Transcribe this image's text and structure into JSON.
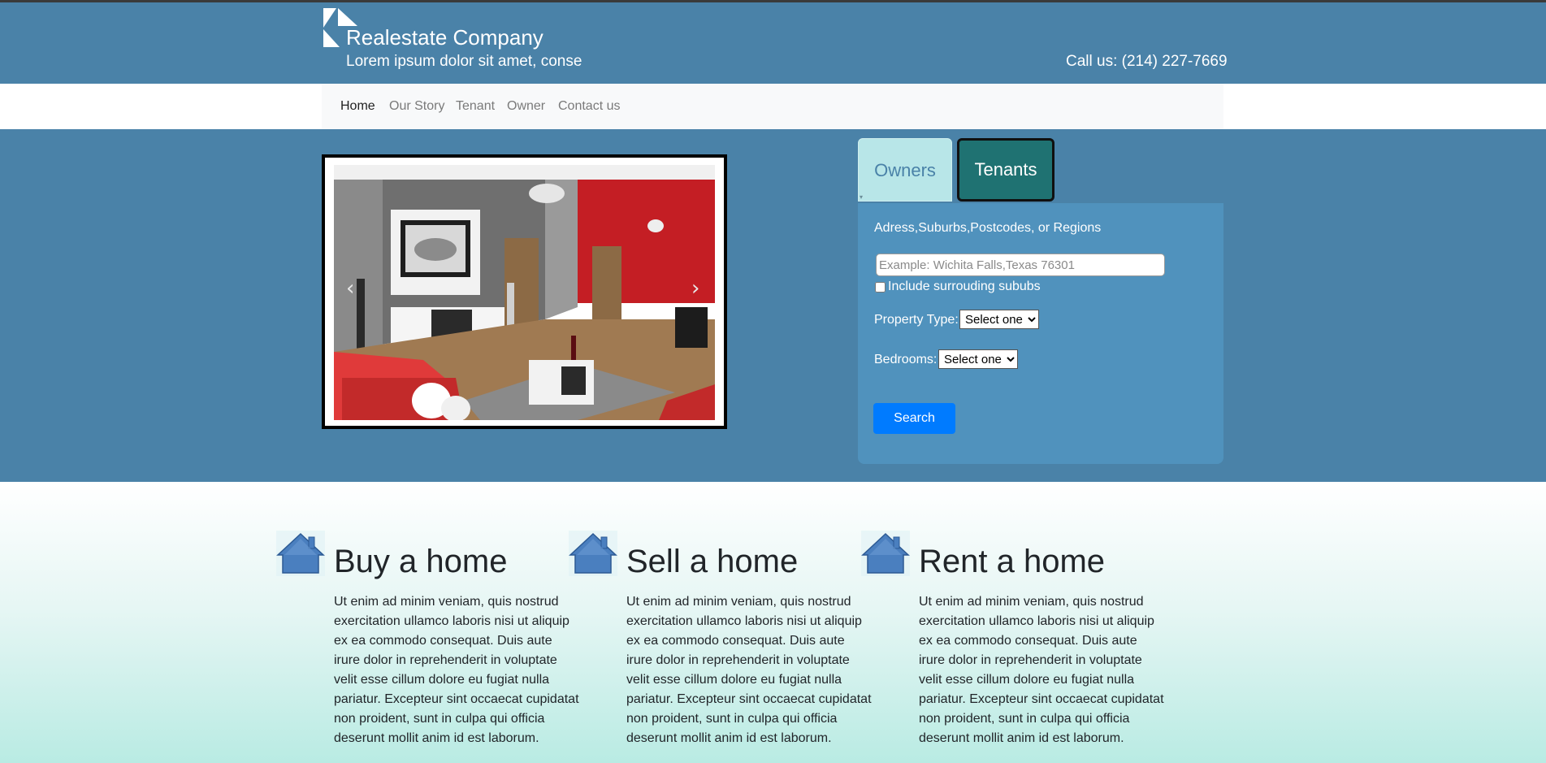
{
  "brand": {
    "title": "Realestate Company",
    "tagline": "Lorem ipsum dolor sit amet, conse",
    "phone": "Call us: (214) 227-7669"
  },
  "nav": {
    "items": [
      {
        "label": "Home",
        "active": true
      },
      {
        "label": "Our Story",
        "active": false
      },
      {
        "label": "Tenant",
        "active": false
      },
      {
        "label": "Owner",
        "active": false
      },
      {
        "label": "Contact us",
        "active": false
      }
    ]
  },
  "carousel": {
    "prev_icon": "chevron-left-icon",
    "next_icon": "chevron-right-icon"
  },
  "search": {
    "tabs": [
      {
        "label": "Owners",
        "selected": false
      },
      {
        "label": "Tenants",
        "selected": true
      }
    ],
    "address_label": "Adress,Suburbs,Postcodes, or Regions",
    "address_value": "",
    "address_placeholder": "Example: Wichita Falls,Texas 76301",
    "include_label": "Include surrouding sububs",
    "include_checked": false,
    "property_type_label": "Property Type:",
    "property_type_value": "Select one",
    "bedrooms_label": "Bedrooms:",
    "bedrooms_value": "Select one",
    "search_button": "Search"
  },
  "features": [
    {
      "title": "Buy a home",
      "icon": "house-icon",
      "text": "Ut enim ad minim veniam, quis nostrud exercitation ullamco laboris nisi ut aliquip ex ea commodo consequat. Duis aute irure dolor in reprehenderit in voluptate velit esse cillum dolore eu fugiat nulla pariatur. Excepteur sint occaecat cupidatat non proident, sunt in culpa qui officia deserunt mollit anim id est laborum."
    },
    {
      "title": "Sell a home",
      "icon": "house-icon",
      "text": "Ut enim ad minim veniam, quis nostrud exercitation ullamco laboris nisi ut aliquip ex ea commodo consequat. Duis aute irure dolor in reprehenderit in voluptate velit esse cillum dolore eu fugiat nulla pariatur. Excepteur sint occaecat cupidatat non proident, sunt in culpa qui officia deserunt mollit anim id est laborum."
    },
    {
      "title": "Rent a home",
      "icon": "house-icon",
      "text": "Ut enim ad minim veniam, quis nostrud exercitation ullamco laboris nisi ut aliquip ex ea commodo consequat. Duis aute irure dolor in reprehenderit in voluptate velit esse cillum dolore eu fugiat nulla pariatur. Excepteur sint occaecat cupidatat non proident, sunt in culpa qui officia deserunt mollit anim id est laborum."
    }
  ],
  "colors": {
    "header_bg": "#4a82a8",
    "panel_bg": "#5092bd",
    "tab_owners_bg": "#b8e6e8",
    "tab_tenants_bg": "#1f7272",
    "button_primary": "#007bff"
  }
}
